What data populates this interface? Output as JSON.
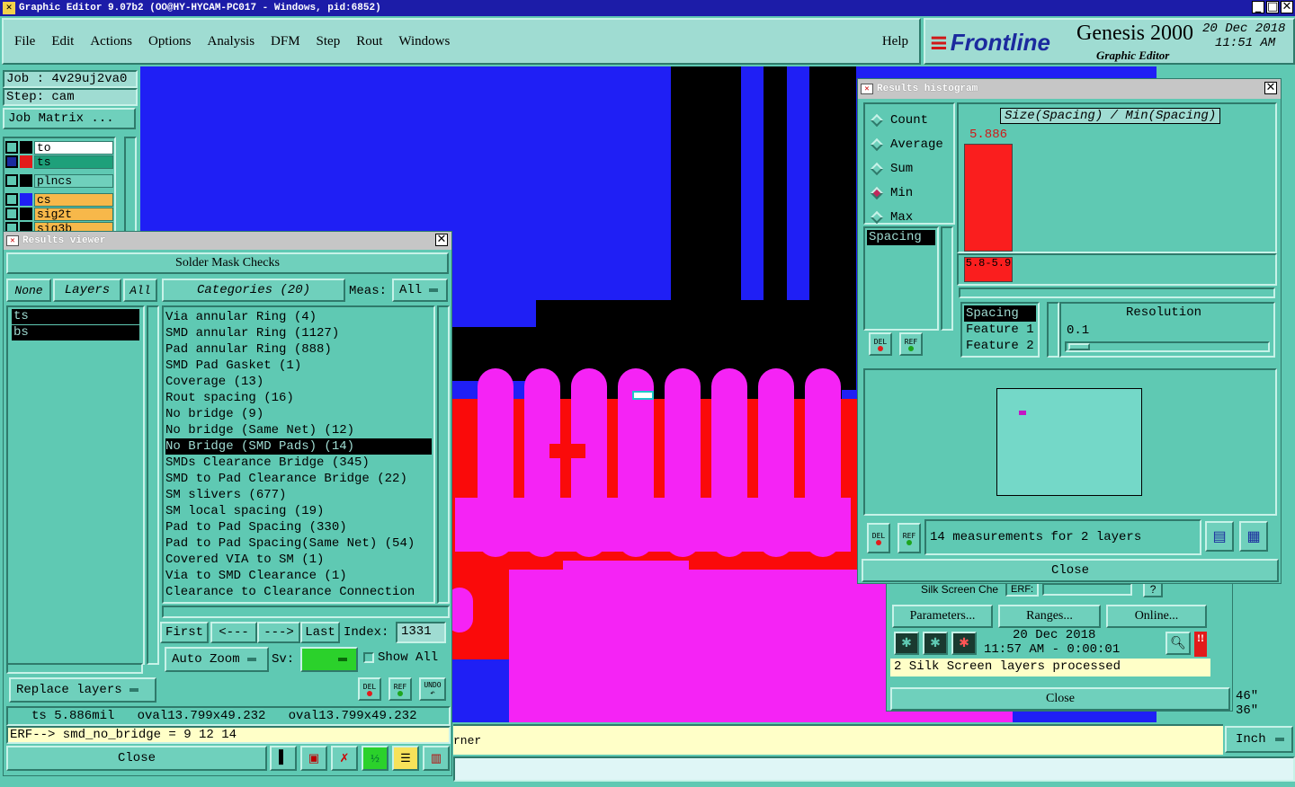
{
  "app": {
    "title": "Graphic Editor 9.07b2 (OO@HY-HYCAM-PC017 - Windows, pid:6852)",
    "menu": [
      "File",
      "Edit",
      "Actions",
      "Options",
      "Analysis",
      "DFM",
      "Step",
      "Rout",
      "Windows"
    ],
    "help": "Help",
    "brand": "Frontline",
    "product": "Genesis 2000",
    "subtitle": "Graphic Editor",
    "date": "20 Dec 2018",
    "time": "11:51 AM"
  },
  "left_panel": {
    "job": "Job : 4v29uj2va0",
    "step": "Step: cam",
    "job_matrix": "Job Matrix ...",
    "layers": [
      {
        "name": "to",
        "color": "#ffffff",
        "mark": "•"
      },
      {
        "name": "ts",
        "color": "#1ea07a",
        "mark": "□"
      },
      {
        "name": "plncs",
        "color": "#6fd0bc",
        "mark": ""
      },
      {
        "name": "cs",
        "color": "#f7b84a",
        "mark": "•"
      },
      {
        "name": "sig2t",
        "color": "#f7b84a",
        "mark": ""
      },
      {
        "name": "sig3b",
        "color": "#f7b84a",
        "mark": ""
      }
    ]
  },
  "results_viewer": {
    "title": "Results viewer",
    "section": "Solder Mask Checks",
    "none": "None",
    "layers_btn": "Layers",
    "all": "All",
    "categories_btn": "Categories (20)",
    "meas_label": "Meas:",
    "meas_value": "All",
    "layer_list": [
      "ts",
      "bs"
    ],
    "categories": [
      "Via annular Ring (4)",
      "SMD annular Ring (1127)",
      "Pad annular Ring (888)",
      "SMD Pad Gasket (1)",
      "Coverage (13)",
      "Rout spacing (16)",
      "No bridge (9)",
      "No bridge (Same Net) (12)",
      "No Bridge (SMD Pads) (14)",
      "SMDs Clearance Bridge (345)",
      "SMD to Pad Clearance Bridge (22)",
      "SM slivers (677)",
      "SM local spacing (19)",
      "Pad to Pad Spacing (330)",
      "Pad to Pad Spacing(Same Net) (54)",
      "Covered VIA to SM (1)",
      "Via to SMD Clearance (1)",
      "Clearance to Clearance Connection"
    ],
    "selected_category": "No Bridge (SMD Pads) (14)",
    "nav": {
      "first": "First",
      "prev": "<---",
      "next": "--->",
      "last": "Last",
      "index_label": "Index:",
      "index_value": "1331"
    },
    "auto_zoom": "Auto Zoom",
    "sv_label": "Sv:",
    "show_all": "Show All",
    "replace_layers": "Replace layers",
    "del": "DEL",
    "ref": "REF",
    "undo": "UNDO",
    "status": "ts 5.886mil   oval13.799x49.232   oval13.799x49.232",
    "erf": "ERF--> smd_no_bridge = 9 12 14",
    "close": "Close"
  },
  "histogram": {
    "title": "Results histogram",
    "modes": [
      "Count",
      "Average",
      "Sum",
      "Min",
      "Max"
    ],
    "selected_mode": "Min",
    "chart_title": "Size(Spacing) / Min(Spacing)",
    "bar_value": "5.886",
    "bar_range": "5.8-5.9",
    "bar_fraction": 1.0,
    "measure_list": [
      "Spacing"
    ],
    "feature_list": [
      "Spacing",
      "Feature 1",
      "Feature 2"
    ],
    "resolution_label": "Resolution",
    "resolution_value": "0.1",
    "summary": "14 measurements for 2 layers",
    "del": "DEL",
    "ref": "REF",
    "close": "Close"
  },
  "silk_panel": {
    "row": "Silk Screen Che",
    "erf": "ERF:",
    "parameters": "Parameters...",
    "ranges": "Ranges...",
    "online": "Online...",
    "date": "20 Dec 2018",
    "time": "11:57 AM - 0:00:01",
    "message": "2 Silk Screen layers processed",
    "close": "Close",
    "coord1": "46\"",
    "coord2": "36\""
  },
  "bottom": {
    "hint": "rner",
    "units": "Inch"
  },
  "colors": {
    "canvas_blue": "#1f1ff5",
    "pad_magenta": "#f523f5",
    "red": "#fa0a0a",
    "panel": "#6fd0bc",
    "selection": "#000000"
  }
}
